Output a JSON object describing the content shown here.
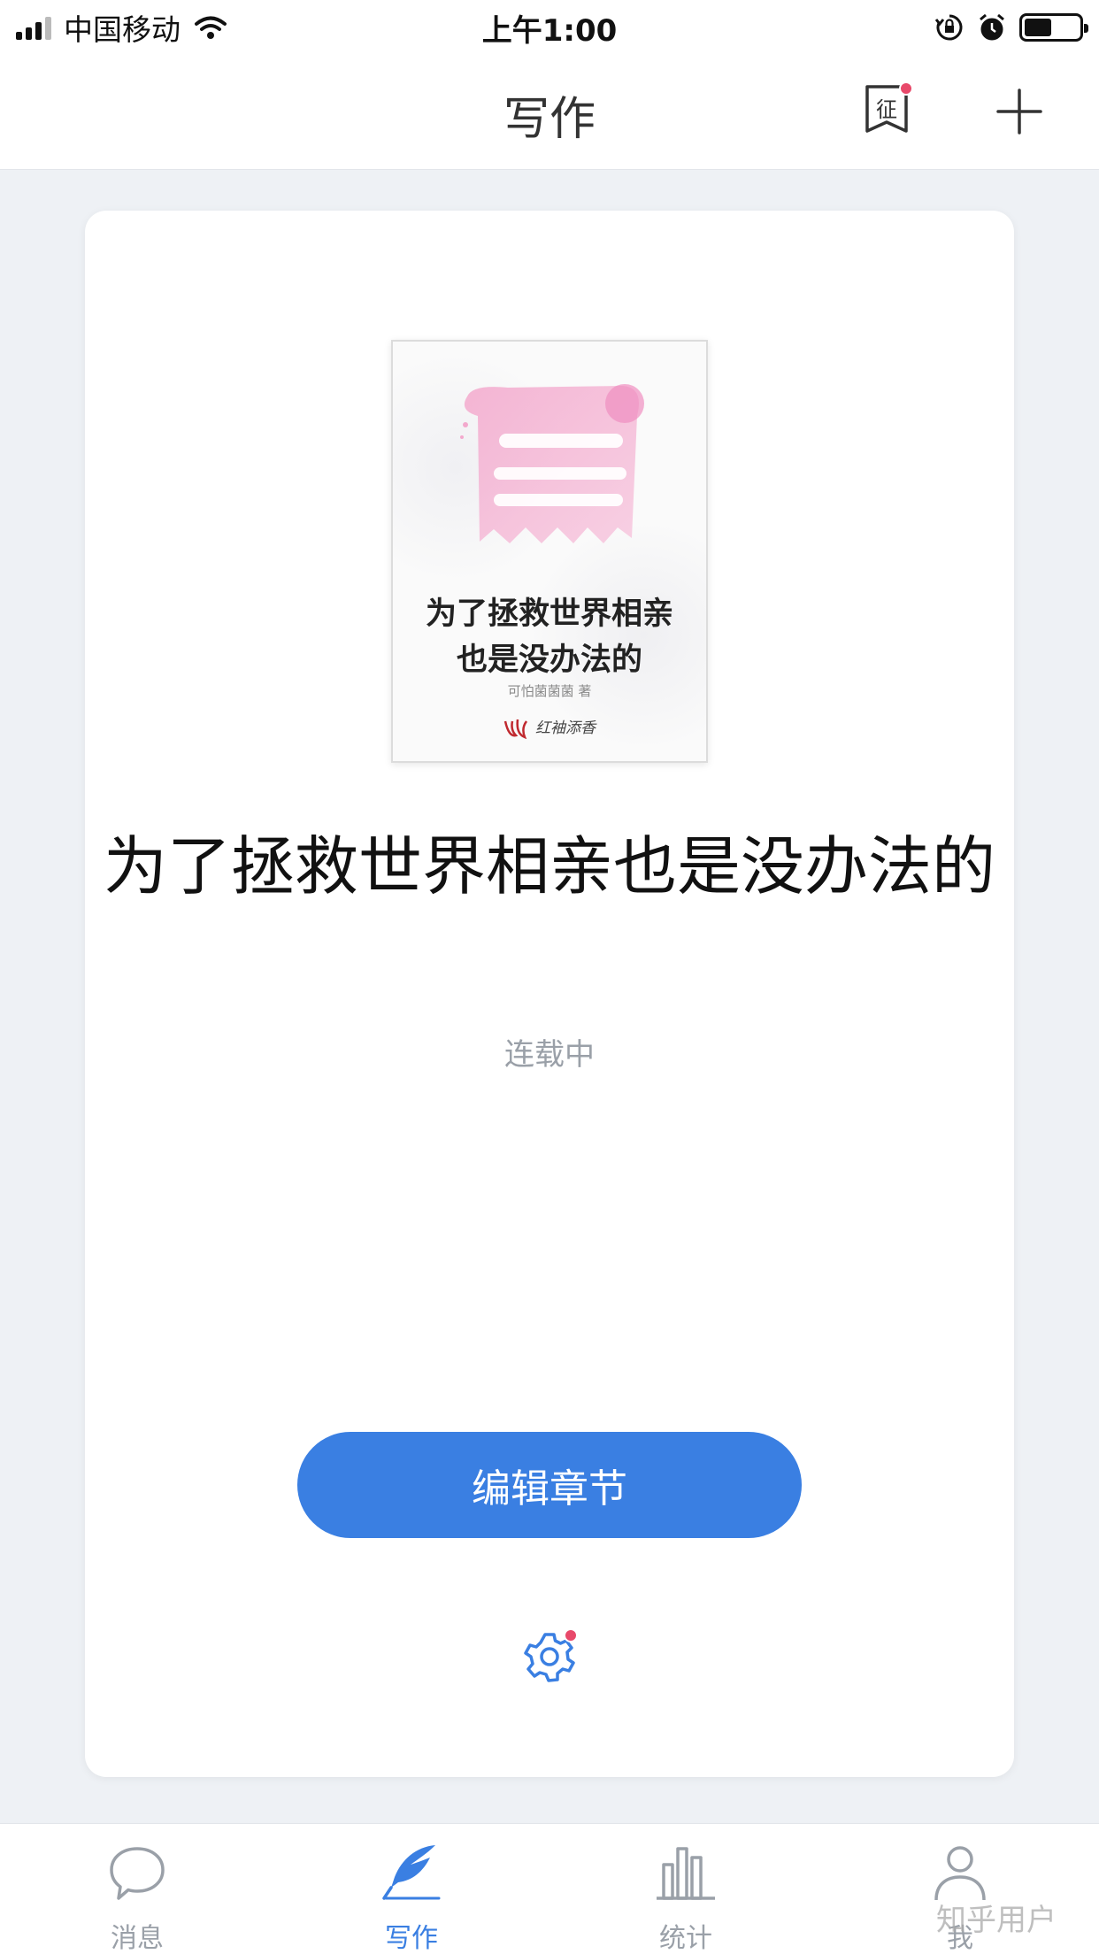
{
  "status_bar": {
    "carrier": "中国移动",
    "time": "上午1:00",
    "battery_level": 0.5
  },
  "nav": {
    "title": "写作",
    "badge_icon": "contest-badge-icon",
    "add_icon": "plus-icon"
  },
  "cover": {
    "title_line1": "为了拯救世界相亲",
    "title_line2": "也是没办法的",
    "author": "可怕菌菌菌 著",
    "publisher": "红袖添香"
  },
  "book": {
    "title": "为了拯救世界相亲也是没办法的",
    "status": "连载中"
  },
  "actions": {
    "edit_label": "编辑章节",
    "settings_icon": "gear-icon"
  },
  "tabs": [
    {
      "label": "消息",
      "icon": "chat-bubble-icon",
      "active": false
    },
    {
      "label": "写作",
      "icon": "quill-icon",
      "active": true
    },
    {
      "label": "统计",
      "icon": "bar-chart-icon",
      "active": false
    },
    {
      "label": "我",
      "icon": "person-icon",
      "active": false
    }
  ],
  "watermark": "知乎用户",
  "colors": {
    "accent": "#3a7fe2",
    "badge": "#e8496a",
    "background": "#eef1f5",
    "muted_text": "#9aa0a8"
  }
}
